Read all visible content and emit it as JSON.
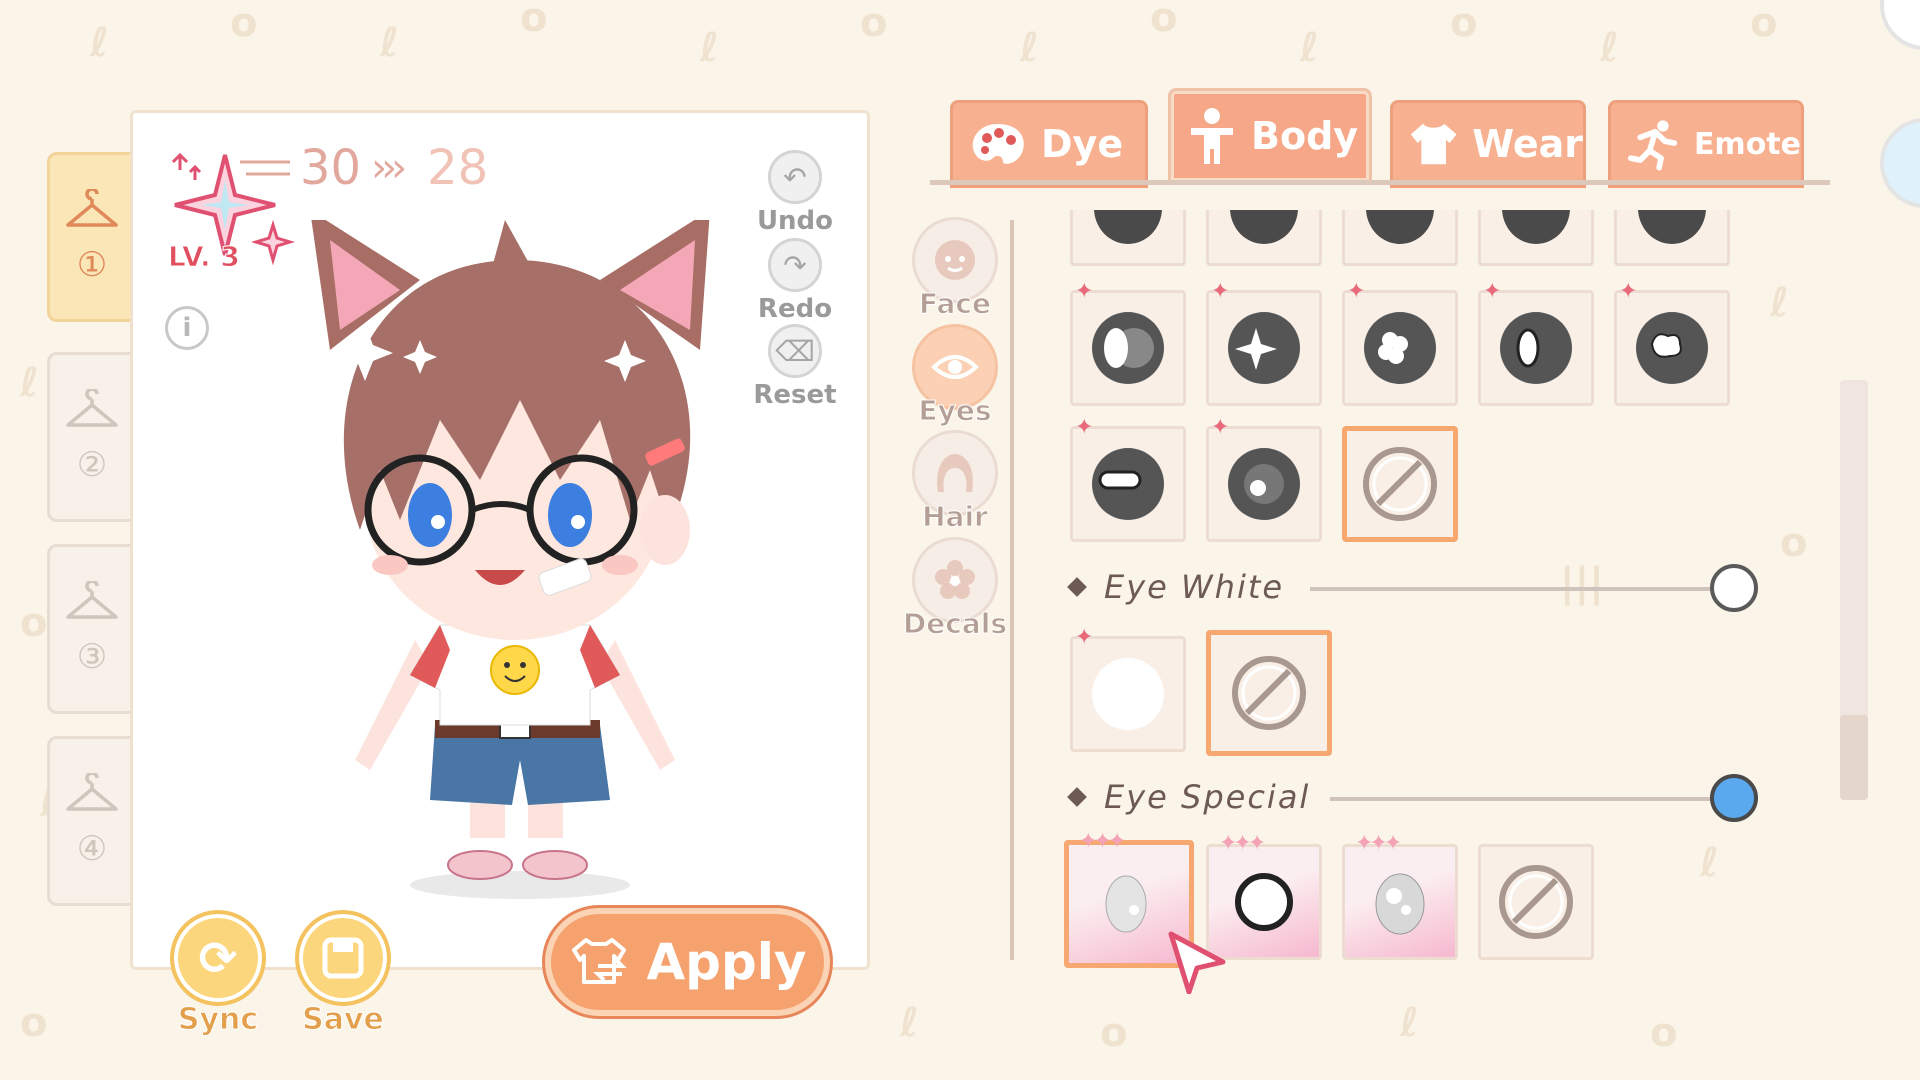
{
  "header": {
    "level_from": "30",
    "level_to": "28",
    "level_badge": "LV. 3"
  },
  "slots": [
    {
      "number": "①",
      "active": true
    },
    {
      "number": "②",
      "active": false
    },
    {
      "number": "③",
      "active": false
    },
    {
      "number": "④",
      "active": false
    }
  ],
  "side_actions": {
    "undo": "Undo",
    "redo": "Redo",
    "reset": "Reset"
  },
  "bottom_actions": {
    "sync": "Sync",
    "save": "Save",
    "apply": "Apply"
  },
  "tabs": [
    {
      "label": "Dye",
      "icon": "palette-icon"
    },
    {
      "label": "Body",
      "icon": "person-icon",
      "active": true
    },
    {
      "label": "Wear",
      "icon": "shirt-icon"
    },
    {
      "label": "Emote",
      "icon": "running-icon"
    }
  ],
  "categories": [
    {
      "label": "Face",
      "icon": "face-icon"
    },
    {
      "label": "Eyes",
      "icon": "eye-icon",
      "active": true
    },
    {
      "label": "Hair",
      "icon": "hair-icon"
    },
    {
      "label": "Decals",
      "icon": "flower-icon"
    }
  ],
  "sections": {
    "eye_white": "Eye White",
    "eye_special": "Eye Special"
  },
  "sliders": {
    "eye_white_level": 1.0,
    "eye_special_level": 1.0
  },
  "colors": {
    "accent": "#f6a26f",
    "tab": "#f7b090",
    "selected_border": "#f6a870",
    "knob_blue": "#5aa9ef"
  }
}
